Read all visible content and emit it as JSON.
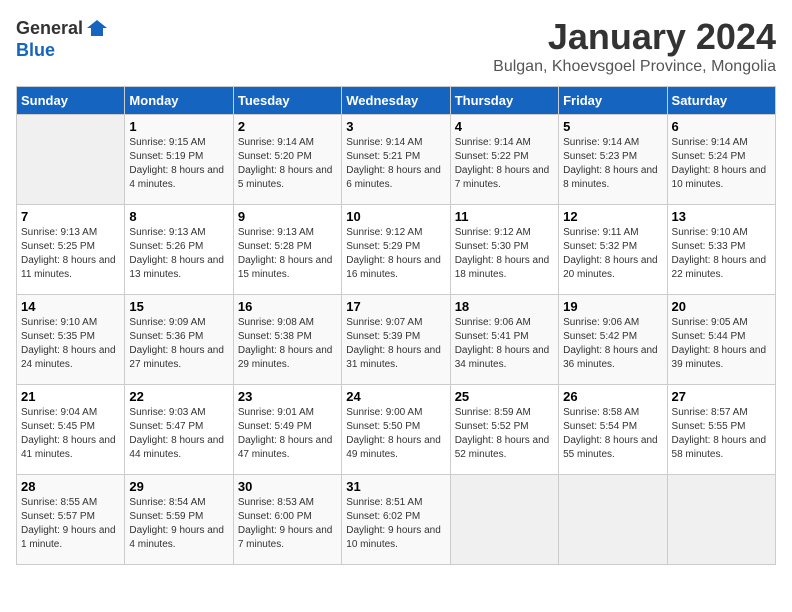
{
  "logo": {
    "general": "General",
    "blue": "Blue"
  },
  "title": "January 2024",
  "subtitle": "Bulgan, Khoevsgoel Province, Mongolia",
  "headers": [
    "Sunday",
    "Monday",
    "Tuesday",
    "Wednesday",
    "Thursday",
    "Friday",
    "Saturday"
  ],
  "weeks": [
    [
      {
        "day": "",
        "empty": true
      },
      {
        "day": "1",
        "sunrise": "Sunrise: 9:15 AM",
        "sunset": "Sunset: 5:19 PM",
        "daylight": "Daylight: 8 hours and 4 minutes."
      },
      {
        "day": "2",
        "sunrise": "Sunrise: 9:14 AM",
        "sunset": "Sunset: 5:20 PM",
        "daylight": "Daylight: 8 hours and 5 minutes."
      },
      {
        "day": "3",
        "sunrise": "Sunrise: 9:14 AM",
        "sunset": "Sunset: 5:21 PM",
        "daylight": "Daylight: 8 hours and 6 minutes."
      },
      {
        "day": "4",
        "sunrise": "Sunrise: 9:14 AM",
        "sunset": "Sunset: 5:22 PM",
        "daylight": "Daylight: 8 hours and 7 minutes."
      },
      {
        "day": "5",
        "sunrise": "Sunrise: 9:14 AM",
        "sunset": "Sunset: 5:23 PM",
        "daylight": "Daylight: 8 hours and 8 minutes."
      },
      {
        "day": "6",
        "sunrise": "Sunrise: 9:14 AM",
        "sunset": "Sunset: 5:24 PM",
        "daylight": "Daylight: 8 hours and 10 minutes."
      }
    ],
    [
      {
        "day": "7",
        "sunrise": "Sunrise: 9:13 AM",
        "sunset": "Sunset: 5:25 PM",
        "daylight": "Daylight: 8 hours and 11 minutes."
      },
      {
        "day": "8",
        "sunrise": "Sunrise: 9:13 AM",
        "sunset": "Sunset: 5:26 PM",
        "daylight": "Daylight: 8 hours and 13 minutes."
      },
      {
        "day": "9",
        "sunrise": "Sunrise: 9:13 AM",
        "sunset": "Sunset: 5:28 PM",
        "daylight": "Daylight: 8 hours and 15 minutes."
      },
      {
        "day": "10",
        "sunrise": "Sunrise: 9:12 AM",
        "sunset": "Sunset: 5:29 PM",
        "daylight": "Daylight: 8 hours and 16 minutes."
      },
      {
        "day": "11",
        "sunrise": "Sunrise: 9:12 AM",
        "sunset": "Sunset: 5:30 PM",
        "daylight": "Daylight: 8 hours and 18 minutes."
      },
      {
        "day": "12",
        "sunrise": "Sunrise: 9:11 AM",
        "sunset": "Sunset: 5:32 PM",
        "daylight": "Daylight: 8 hours and 20 minutes."
      },
      {
        "day": "13",
        "sunrise": "Sunrise: 9:10 AM",
        "sunset": "Sunset: 5:33 PM",
        "daylight": "Daylight: 8 hours and 22 minutes."
      }
    ],
    [
      {
        "day": "14",
        "sunrise": "Sunrise: 9:10 AM",
        "sunset": "Sunset: 5:35 PM",
        "daylight": "Daylight: 8 hours and 24 minutes."
      },
      {
        "day": "15",
        "sunrise": "Sunrise: 9:09 AM",
        "sunset": "Sunset: 5:36 PM",
        "daylight": "Daylight: 8 hours and 27 minutes."
      },
      {
        "day": "16",
        "sunrise": "Sunrise: 9:08 AM",
        "sunset": "Sunset: 5:38 PM",
        "daylight": "Daylight: 8 hours and 29 minutes."
      },
      {
        "day": "17",
        "sunrise": "Sunrise: 9:07 AM",
        "sunset": "Sunset: 5:39 PM",
        "daylight": "Daylight: 8 hours and 31 minutes."
      },
      {
        "day": "18",
        "sunrise": "Sunrise: 9:06 AM",
        "sunset": "Sunset: 5:41 PM",
        "daylight": "Daylight: 8 hours and 34 minutes."
      },
      {
        "day": "19",
        "sunrise": "Sunrise: 9:06 AM",
        "sunset": "Sunset: 5:42 PM",
        "daylight": "Daylight: 8 hours and 36 minutes."
      },
      {
        "day": "20",
        "sunrise": "Sunrise: 9:05 AM",
        "sunset": "Sunset: 5:44 PM",
        "daylight": "Daylight: 8 hours and 39 minutes."
      }
    ],
    [
      {
        "day": "21",
        "sunrise": "Sunrise: 9:04 AM",
        "sunset": "Sunset: 5:45 PM",
        "daylight": "Daylight: 8 hours and 41 minutes."
      },
      {
        "day": "22",
        "sunrise": "Sunrise: 9:03 AM",
        "sunset": "Sunset: 5:47 PM",
        "daylight": "Daylight: 8 hours and 44 minutes."
      },
      {
        "day": "23",
        "sunrise": "Sunrise: 9:01 AM",
        "sunset": "Sunset: 5:49 PM",
        "daylight": "Daylight: 8 hours and 47 minutes."
      },
      {
        "day": "24",
        "sunrise": "Sunrise: 9:00 AM",
        "sunset": "Sunset: 5:50 PM",
        "daylight": "Daylight: 8 hours and 49 minutes."
      },
      {
        "day": "25",
        "sunrise": "Sunrise: 8:59 AM",
        "sunset": "Sunset: 5:52 PM",
        "daylight": "Daylight: 8 hours and 52 minutes."
      },
      {
        "day": "26",
        "sunrise": "Sunrise: 8:58 AM",
        "sunset": "Sunset: 5:54 PM",
        "daylight": "Daylight: 8 hours and 55 minutes."
      },
      {
        "day": "27",
        "sunrise": "Sunrise: 8:57 AM",
        "sunset": "Sunset: 5:55 PM",
        "daylight": "Daylight: 8 hours and 58 minutes."
      }
    ],
    [
      {
        "day": "28",
        "sunrise": "Sunrise: 8:55 AM",
        "sunset": "Sunset: 5:57 PM",
        "daylight": "Daylight: 9 hours and 1 minute."
      },
      {
        "day": "29",
        "sunrise": "Sunrise: 8:54 AM",
        "sunset": "Sunset: 5:59 PM",
        "daylight": "Daylight: 9 hours and 4 minutes."
      },
      {
        "day": "30",
        "sunrise": "Sunrise: 8:53 AM",
        "sunset": "Sunset: 6:00 PM",
        "daylight": "Daylight: 9 hours and 7 minutes."
      },
      {
        "day": "31",
        "sunrise": "Sunrise: 8:51 AM",
        "sunset": "Sunset: 6:02 PM",
        "daylight": "Daylight: 9 hours and 10 minutes."
      },
      {
        "day": "",
        "empty": true
      },
      {
        "day": "",
        "empty": true
      },
      {
        "day": "",
        "empty": true
      }
    ]
  ]
}
